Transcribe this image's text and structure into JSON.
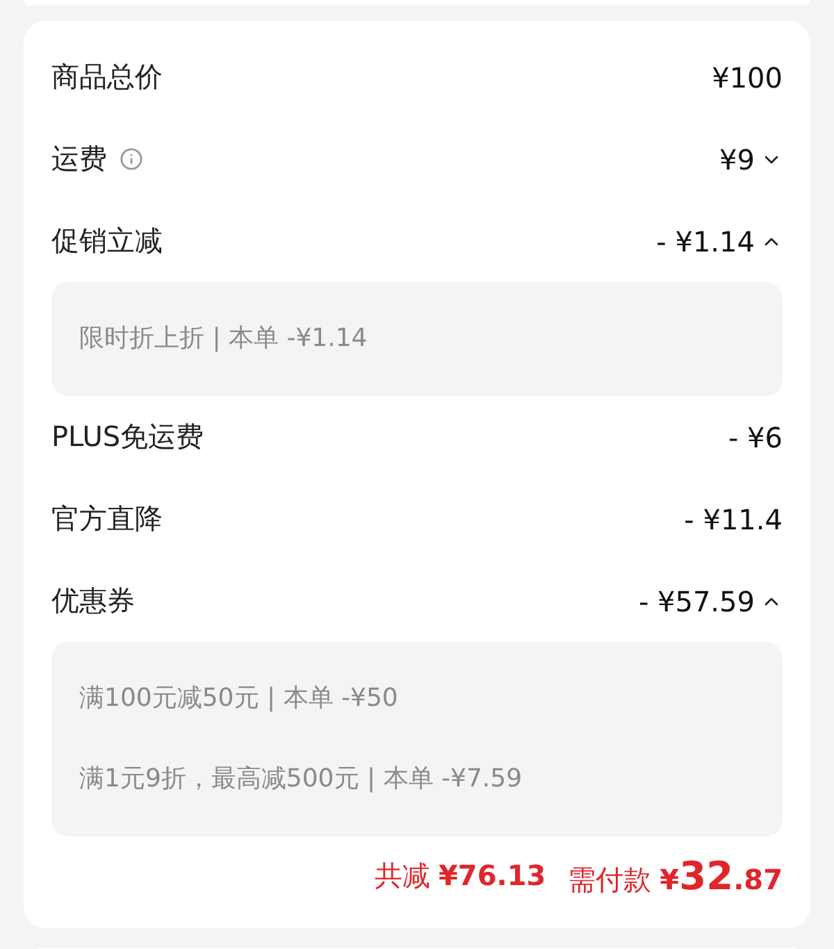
{
  "rows": [
    {
      "label": "商品总价",
      "value": "¥100",
      "info": false
    },
    {
      "label": "运费",
      "value": "¥9",
      "info": true,
      "expanded": false
    },
    {
      "label": "促销立减",
      "value": "- ¥1.14",
      "info": false,
      "expanded": true,
      "details": [
        "限时折上折 | 本单 -¥1.14"
      ]
    },
    {
      "label": "PLUS免运费",
      "value": "- ¥6",
      "info": false
    },
    {
      "label": "官方直降",
      "value": "- ¥11.4",
      "info": false
    },
    {
      "label": "优惠券",
      "value": "- ¥57.59",
      "info": false,
      "expanded": true,
      "details": [
        "满100元减50元 | 本单 -¥50",
        "满1元9折，最高减500元 | 本单 -¥7.59"
      ]
    }
  ],
  "total": {
    "discount_label": "共减",
    "discount": "¥76.13",
    "pay_label": "需付款",
    "pay_currency": "¥",
    "pay_whole": "32",
    "pay_fraction": ".87"
  }
}
